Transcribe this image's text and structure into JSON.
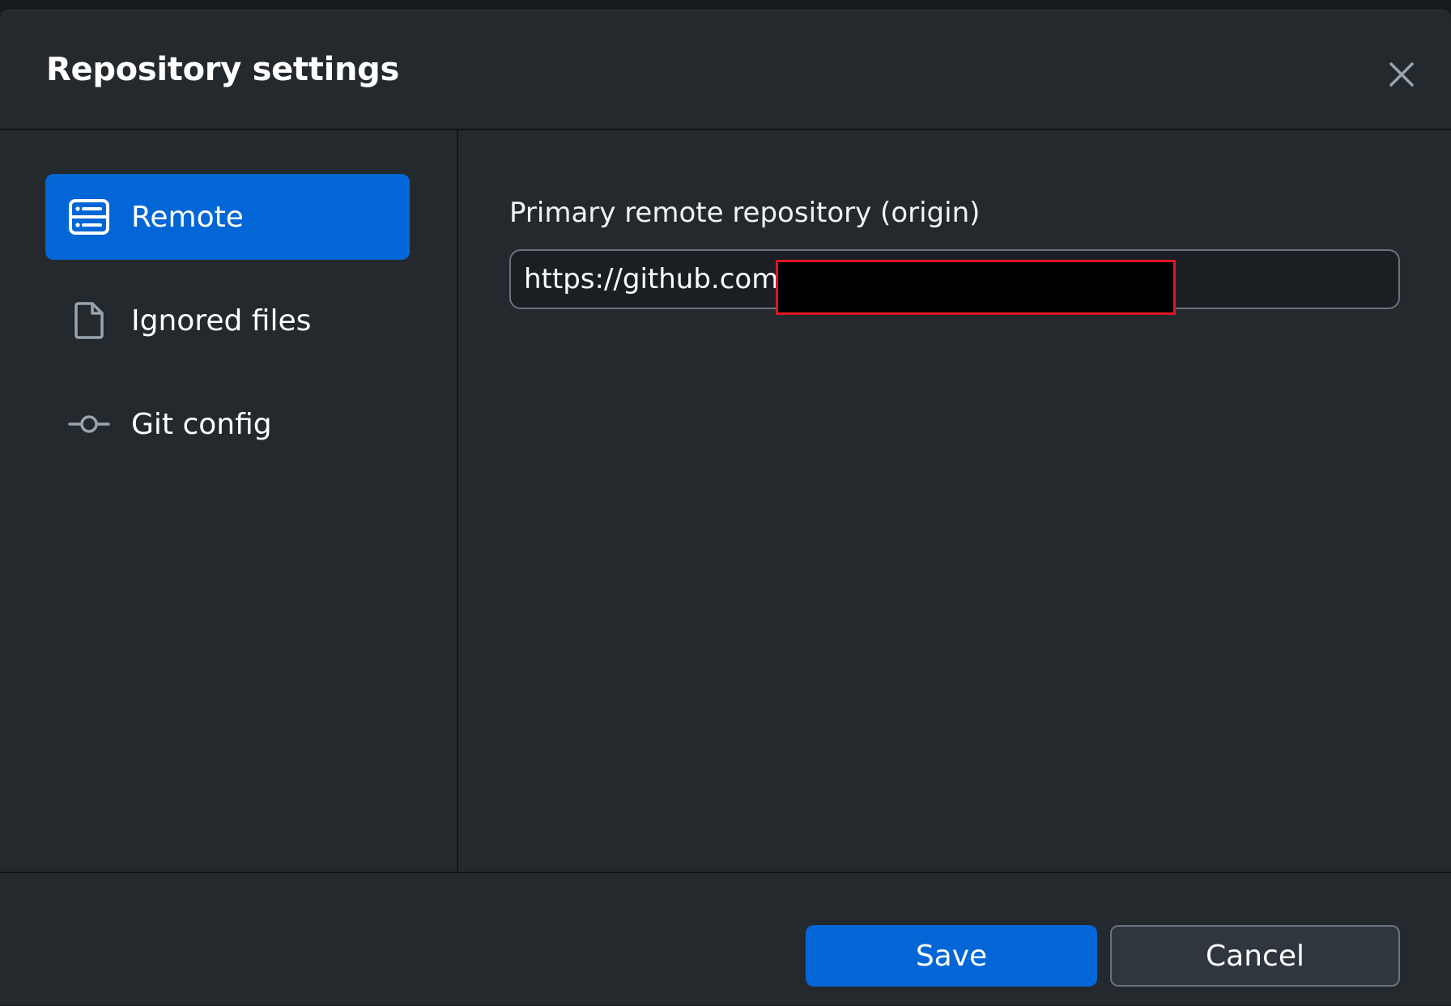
{
  "dialog": {
    "title": "Repository settings",
    "close_icon": "close-icon"
  },
  "sidebar": {
    "items": [
      {
        "label": "Remote",
        "icon": "server-icon",
        "active": true
      },
      {
        "label": "Ignored files",
        "icon": "file-icon",
        "active": false
      },
      {
        "label": "Git config",
        "icon": "git-commit-icon",
        "active": false
      }
    ]
  },
  "remote": {
    "label": "Primary remote repository (origin)",
    "url_value": "https://github.com/                              s.git"
  },
  "footer": {
    "save_label": "Save",
    "cancel_label": "Cancel"
  },
  "colors": {
    "accent": "#0366d6",
    "background": "#24292e",
    "redaction_border": "#e0161f"
  }
}
